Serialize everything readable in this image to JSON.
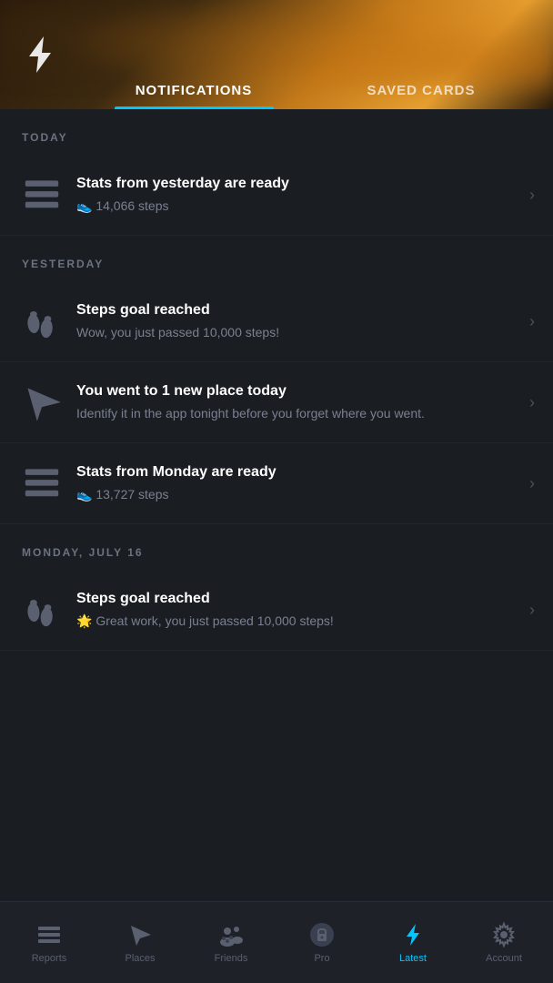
{
  "header": {
    "tabs": [
      {
        "id": "notifications",
        "label": "NOTIFICATIONS",
        "active": true
      },
      {
        "id": "saved_cards",
        "label": "SAVED CARDS",
        "active": false
      }
    ]
  },
  "sections": [
    {
      "label": "TODAY",
      "items": [
        {
          "id": "stats_yesterday",
          "icon_type": "layers",
          "title": "Stats from yesterday are ready",
          "subtitle": "👟 14,066 steps",
          "has_chevron": true
        }
      ]
    },
    {
      "label": "YESTERDAY",
      "items": [
        {
          "id": "steps_goal_yesterday",
          "icon_type": "footprint",
          "title": "Steps goal reached",
          "subtitle": "Wow, you just passed 10,000 steps!",
          "has_chevron": true
        },
        {
          "id": "new_place_yesterday",
          "icon_type": "location",
          "title": "You went to 1 new place today",
          "subtitle": "Identify it in the app tonight before you forget where you went.",
          "has_chevron": true
        },
        {
          "id": "stats_monday",
          "icon_type": "layers",
          "title": "Stats from Monday are ready",
          "subtitle": "👟 13,727 steps",
          "has_chevron": true
        }
      ]
    },
    {
      "label": "MONDAY, JULY 16",
      "items": [
        {
          "id": "steps_goal_monday",
          "icon_type": "footprint",
          "title": "Steps goal reached",
          "subtitle": "🌟 Great work, you just passed 10,000 steps!",
          "has_chevron": true
        }
      ]
    }
  ],
  "bottom_nav": [
    {
      "id": "reports",
      "label": "Reports",
      "icon": "layers",
      "active": false
    },
    {
      "id": "places",
      "label": "Places",
      "icon": "location",
      "active": false
    },
    {
      "id": "friends",
      "label": "Friends",
      "icon": "friends",
      "active": false
    },
    {
      "id": "pro",
      "label": "Pro",
      "icon": "lock",
      "active": false
    },
    {
      "id": "latest",
      "label": "Latest",
      "icon": "lightning",
      "active": true
    },
    {
      "id": "account",
      "label": "Account",
      "icon": "gear",
      "active": false
    }
  ]
}
